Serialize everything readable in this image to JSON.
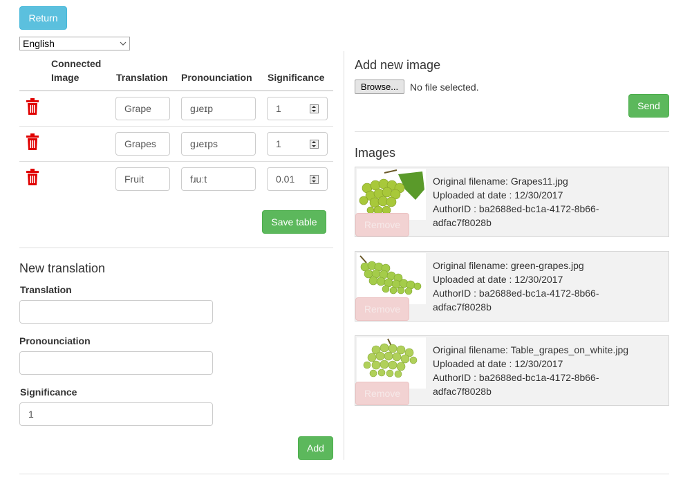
{
  "top": {
    "return_label": "Return",
    "language": "English"
  },
  "table": {
    "headers": {
      "image": "Connected Image",
      "translation": "Translation",
      "pronounciation": "Pronounciation",
      "significance": "Significance"
    },
    "rows": [
      {
        "translation": "Grape",
        "pronounciation": "ɡɹeɪp",
        "significance": "1"
      },
      {
        "translation": "Grapes",
        "pronounciation": "ɡɹeɪps",
        "significance": "1"
      },
      {
        "translation": "Fruit",
        "pronounciation": "fɹuːt",
        "significance": "0.01"
      }
    ],
    "save_label": "Save table"
  },
  "new_translation": {
    "title": "New translation",
    "translation_label": "Translation",
    "translation_value": "",
    "pronounciation_label": "Pronounciation",
    "pronounciation_value": "",
    "significance_label": "Significance",
    "significance_value": "1",
    "add_label": "Add"
  },
  "add_image": {
    "title": "Add new image",
    "browse_label": "Browse...",
    "file_status": "No file selected.",
    "send_label": "Send"
  },
  "images": {
    "title": "Images",
    "items": [
      {
        "filename": "Original filename: Grapes11.jpg",
        "date": "Uploaded at date : 12/30/2017",
        "author1": "AuthorID : ba2688ed-bc1a-4172-8b66-",
        "author2": "adfac7f8028b",
        "remove": "Remove"
      },
      {
        "filename": "Original filename: green-grapes.jpg",
        "date": "Uploaded at date : 12/30/2017",
        "author1": "AuthorID : ba2688ed-bc1a-4172-8b66-",
        "author2": "adfac7f8028b",
        "remove": "Remove"
      },
      {
        "filename": "Original filename: Table_grapes_on_white.jpg",
        "date": "Uploaded at date : 12/30/2017",
        "author1": "AuthorID : ba2688ed-bc1a-4172-8b66-",
        "author2": "adfac7f8028b",
        "remove": "Remove"
      }
    ]
  },
  "colors": {
    "info": "#5bc0de",
    "success": "#5cb85c",
    "danger": "#e00000"
  }
}
